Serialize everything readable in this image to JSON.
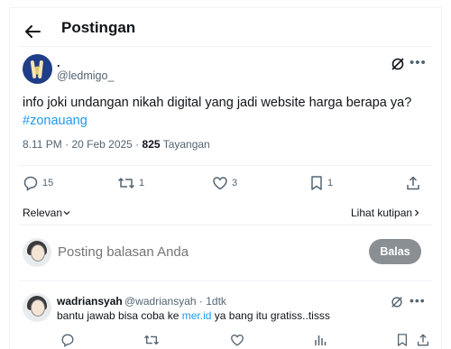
{
  "header": {
    "title": "Postingan"
  },
  "post": {
    "display_name": ".",
    "handle": "@ledmigo_",
    "text": "info joki undangan nikah digital yang jadi website harga berapa ya?",
    "hashtag": "#zonauang",
    "time": "8.11 PM · 20 Feb 2025 ·",
    "views_count": "825",
    "views_label": "Tayangan",
    "stats": {
      "replies": "15",
      "reposts": "1",
      "likes": "3",
      "bookmarks": "1"
    }
  },
  "sort": {
    "relevan_label": "Relevan",
    "quotes_label": "Lihat kutipan"
  },
  "composer": {
    "placeholder": "Posting balasan Anda",
    "reply_button": "Balas"
  },
  "reply": {
    "display_name": "wadriansyah",
    "sub": "@wadriansyah · 1dtk",
    "text_before": "bantu jawab bisa coba ke ",
    "link": "mer.id",
    "text_after": " ya bang itu gratiss..tisss"
  },
  "colors": {
    "accent": "#1d9bf0",
    "muted": "#536471",
    "text": "#0f1419",
    "button_disabled": "#8a8f94"
  },
  "icons": [
    "back-arrow-icon",
    "grok-icon",
    "more-icon",
    "reply-icon",
    "repost-icon",
    "like-icon",
    "bookmark-icon",
    "share-icon",
    "views-icon",
    "chevron-down-icon",
    "chevron-right-icon"
  ]
}
